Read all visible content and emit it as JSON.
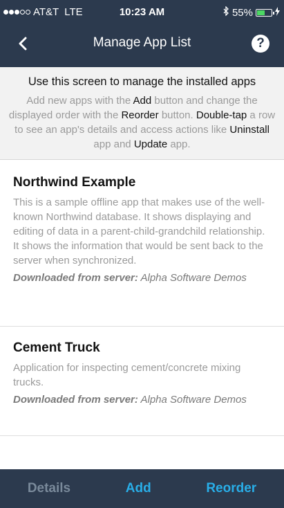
{
  "status": {
    "carrier": "AT&T",
    "network": "LTE",
    "time": "10:23 AM",
    "battery": "55%",
    "battery_level": 0.55,
    "signal_bars": [
      true,
      true,
      true,
      false,
      false
    ]
  },
  "navbar": {
    "title": "Manage App List",
    "back_icon": "chevron-left-icon",
    "help_label": "?"
  },
  "intro": {
    "heading": "Use this screen to manage the installed apps",
    "t1": "Add new apps with the ",
    "add": "Add",
    "t2": " button and change the displayed order with the ",
    "reorder": "Reorder",
    "t3": " button. ",
    "double_tap": "Double-tap",
    "t4": " a row to see an app's details and access actions like ",
    "uninstall": "Uninstall",
    "t5": " app and ",
    "update": "Update",
    "t6": " app."
  },
  "apps": [
    {
      "title": "Northwind Example",
      "description": "This is a sample offline app that makes use of the well-known Northwind database. It shows displaying and editing of data in a parent-child-grandchild relationship. It shows the information that would be sent back to the server when synchronized.",
      "source_label": "Downloaded from server:",
      "source_value": " Alpha Software Demos"
    },
    {
      "title": "Cement Truck",
      "description": "Application for inspecting cement/concrete mixing trucks.",
      "source_label": "Downloaded from server:",
      "source_value": " Alpha Software Demos"
    }
  ],
  "tabbar": {
    "details": "Details",
    "add": "Add",
    "reorder": "Reorder"
  },
  "colors": {
    "bar": "#2c3a4e",
    "accent": "#29aee8",
    "disabled": "#7a8a9b"
  }
}
